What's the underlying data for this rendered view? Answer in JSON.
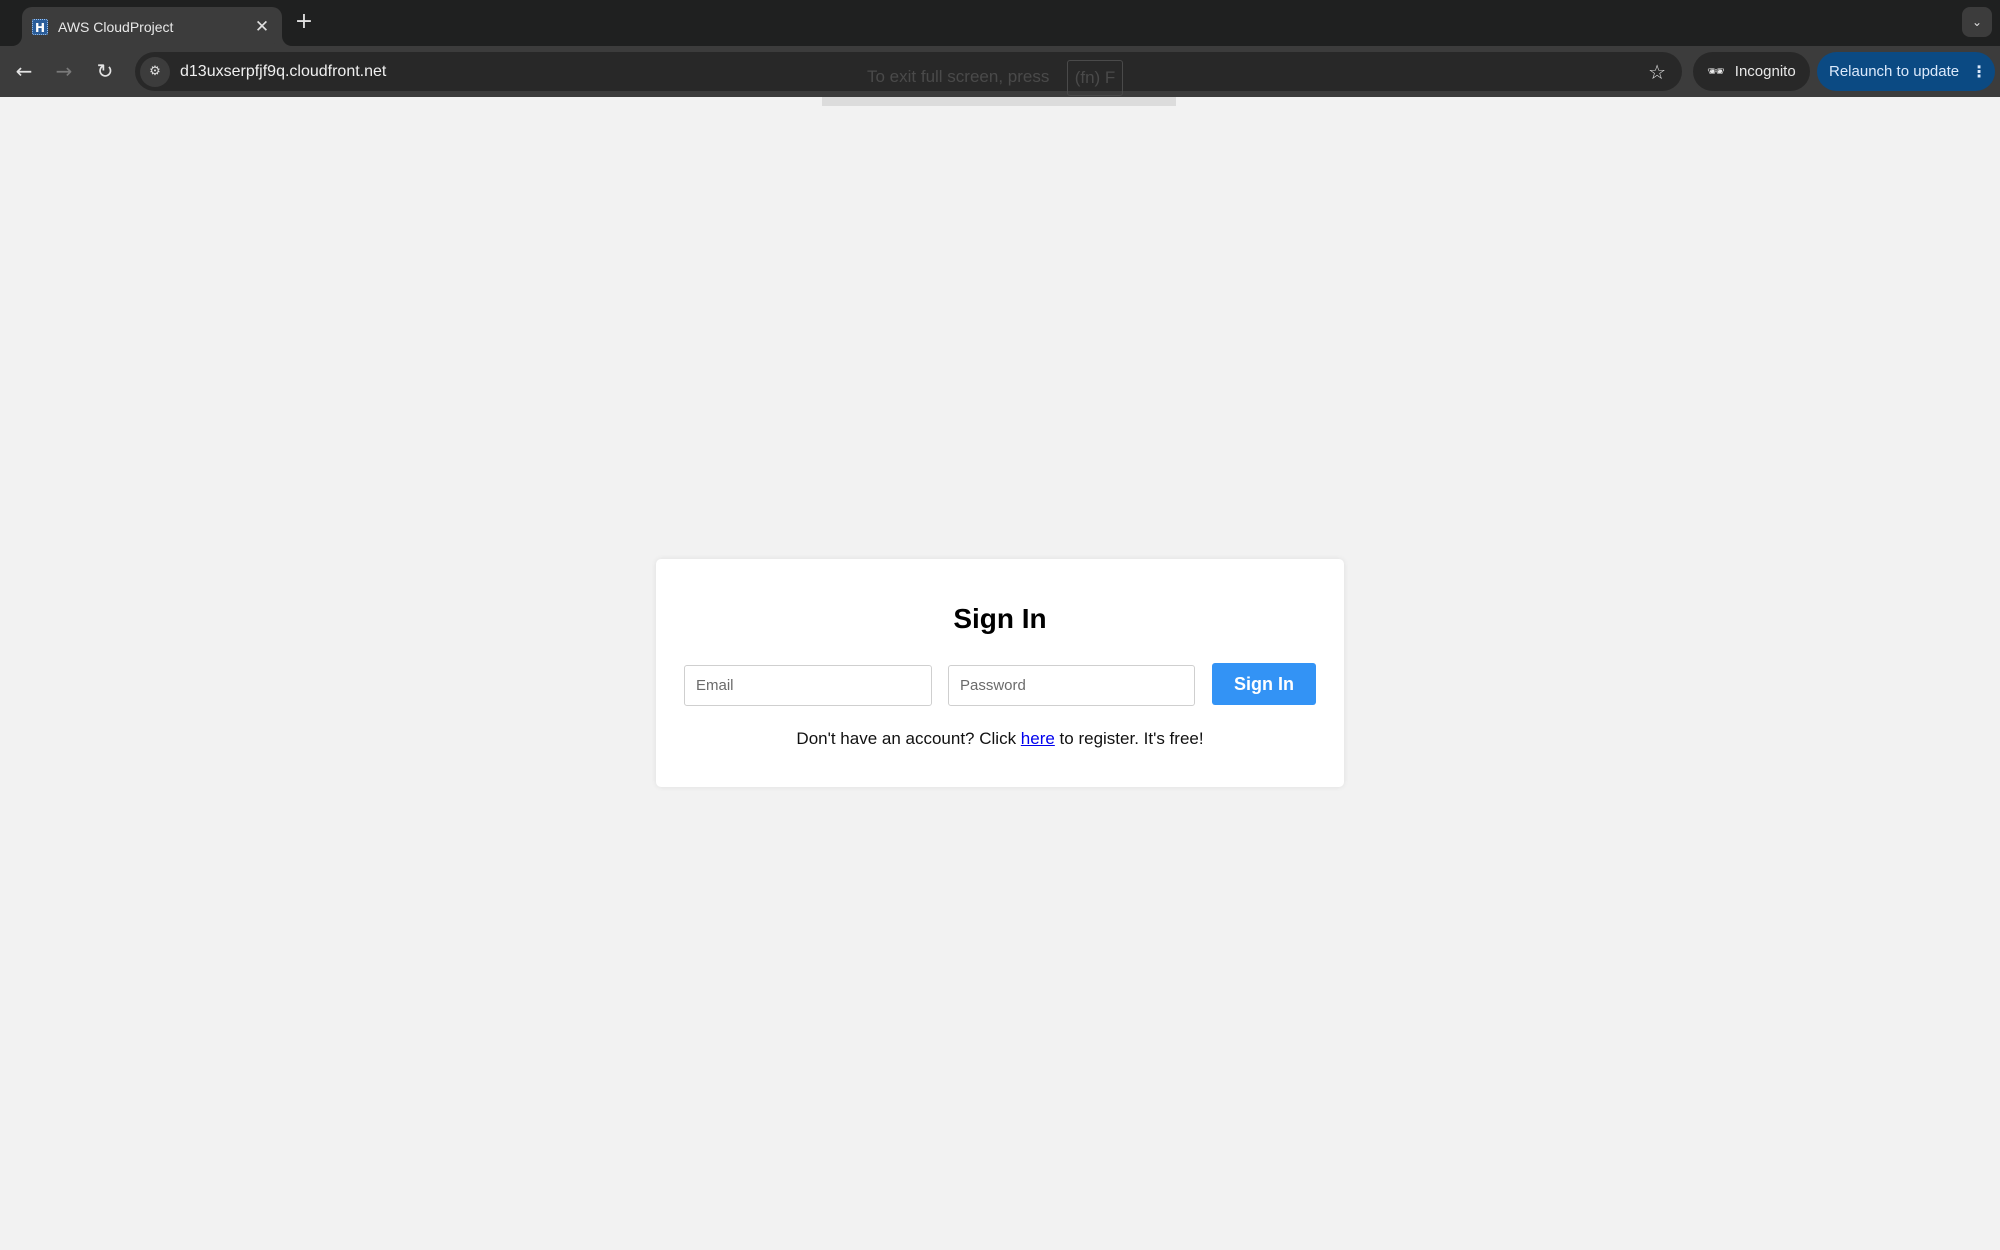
{
  "browser": {
    "tab": {
      "favicon_glyph": "H",
      "title": "AWS CloudProject",
      "close_glyph": "✕"
    },
    "new_tab_glyph": "+",
    "tab_search_glyph": "⌄",
    "nav": {
      "back_glyph": "←",
      "forward_glyph": "→",
      "reload_glyph": "↻"
    },
    "omnibox": {
      "site_info_glyph": "⚙",
      "url": "d13uxserpfjf9q.cloudfront.net",
      "bookmark_glyph": "☆"
    },
    "incognito": {
      "icon_glyph": "🕶",
      "label": "Incognito"
    },
    "relaunch": {
      "label": "Relaunch to update",
      "menu_glyph": "⋮",
      "color": "#0b4a83"
    },
    "fullscreen_hint": {
      "text": "To exit full screen, press",
      "key": "(fn) F"
    }
  },
  "page": {
    "title": "Sign In",
    "email": {
      "placeholder": "Email",
      "value": ""
    },
    "password": {
      "placeholder": "Password",
      "value": ""
    },
    "submit_label": "Sign In",
    "submit_color": "#3393f5",
    "register": {
      "prefix": "Don't have an account? Click ",
      "link_text": "here",
      "suffix": " to register. It's free!"
    }
  }
}
